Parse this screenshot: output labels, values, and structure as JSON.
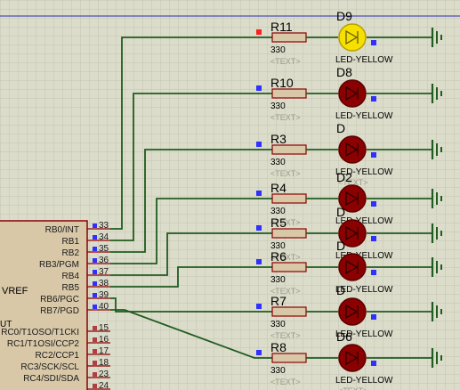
{
  "schematic": {
    "mcu": {
      "left_labels": [
        {
          "text": "VREF"
        },
        {
          "text": "UT"
        }
      ],
      "pins": [
        {
          "num": "33",
          "name": "RB0/INT"
        },
        {
          "num": "34",
          "name": "RB1"
        },
        {
          "num": "35",
          "name": "RB2"
        },
        {
          "num": "36",
          "name": "RB3/PGM"
        },
        {
          "num": "37",
          "name": "RB4"
        },
        {
          "num": "38",
          "name": "RB5"
        },
        {
          "num": "39",
          "name": "RB6/PGC"
        },
        {
          "num": "40",
          "name": "RB7/PGD"
        },
        {
          "num": "15",
          "name": "RC0/T1OSO/T1CKI"
        },
        {
          "num": "16",
          "name": "RC1/T1OSI/CCP2"
        },
        {
          "num": "17",
          "name": "RC2/CCP1"
        },
        {
          "num": "18",
          "name": "RC3/SCK/SCL"
        },
        {
          "num": "23",
          "name": "RC4/SDI/SDA"
        },
        {
          "num": "24",
          "name": ""
        }
      ]
    },
    "resistors": [
      {
        "ref": "R11",
        "value": "330",
        "text": "<TEXT>"
      },
      {
        "ref": "R10",
        "value": "330",
        "text": "<TEXT>"
      },
      {
        "ref": "R3",
        "value": "330",
        "text": "<TEXT>"
      },
      {
        "ref": "R4",
        "value": "330",
        "text": "<TEXT>"
      },
      {
        "ref": "R5",
        "value": "330",
        "text": "<TEXT>"
      },
      {
        "ref": "R6",
        "value": "330",
        "text": "<TEXT>"
      },
      {
        "ref": "R7",
        "value": "330",
        "text": "<TEXT>"
      },
      {
        "ref": "R8",
        "value": "330",
        "text": "<TEXT>"
      }
    ],
    "leds": [
      {
        "ref": "D9",
        "type": "LED-YELLOW",
        "text": "",
        "lit": true
      },
      {
        "ref": "D8",
        "type": "LED-YELLOW",
        "text": "",
        "lit": false
      },
      {
        "ref": "D",
        "type": "LED-YELLOW",
        "text": "<TEXT>",
        "lit": false
      },
      {
        "ref": "D2",
        "type": "LED-YELLOW",
        "text": "",
        "lit": false
      },
      {
        "ref": "D",
        "type": "LED-YELLOW",
        "text": "",
        "lit": false
      },
      {
        "ref": "D",
        "type": "LED-YELLOW",
        "text": "",
        "lit": false
      },
      {
        "ref": "D",
        "type": "LED-YELLOW",
        "text": "",
        "lit": false
      },
      {
        "ref": "D6",
        "type": "LED-YELLOW",
        "text": "<TEXT>",
        "lit": false
      }
    ],
    "colors": {
      "background": "#dcdccb",
      "grid": "#c4c4b2",
      "wire": "#1f5c1f",
      "component": "#8b0000",
      "resistor_fill": "#d8c8a8",
      "led_off": "#8b0000",
      "led_on": "#f5e000",
      "pin_marker": "#3030ff",
      "pin_active": "#ff2020"
    }
  }
}
